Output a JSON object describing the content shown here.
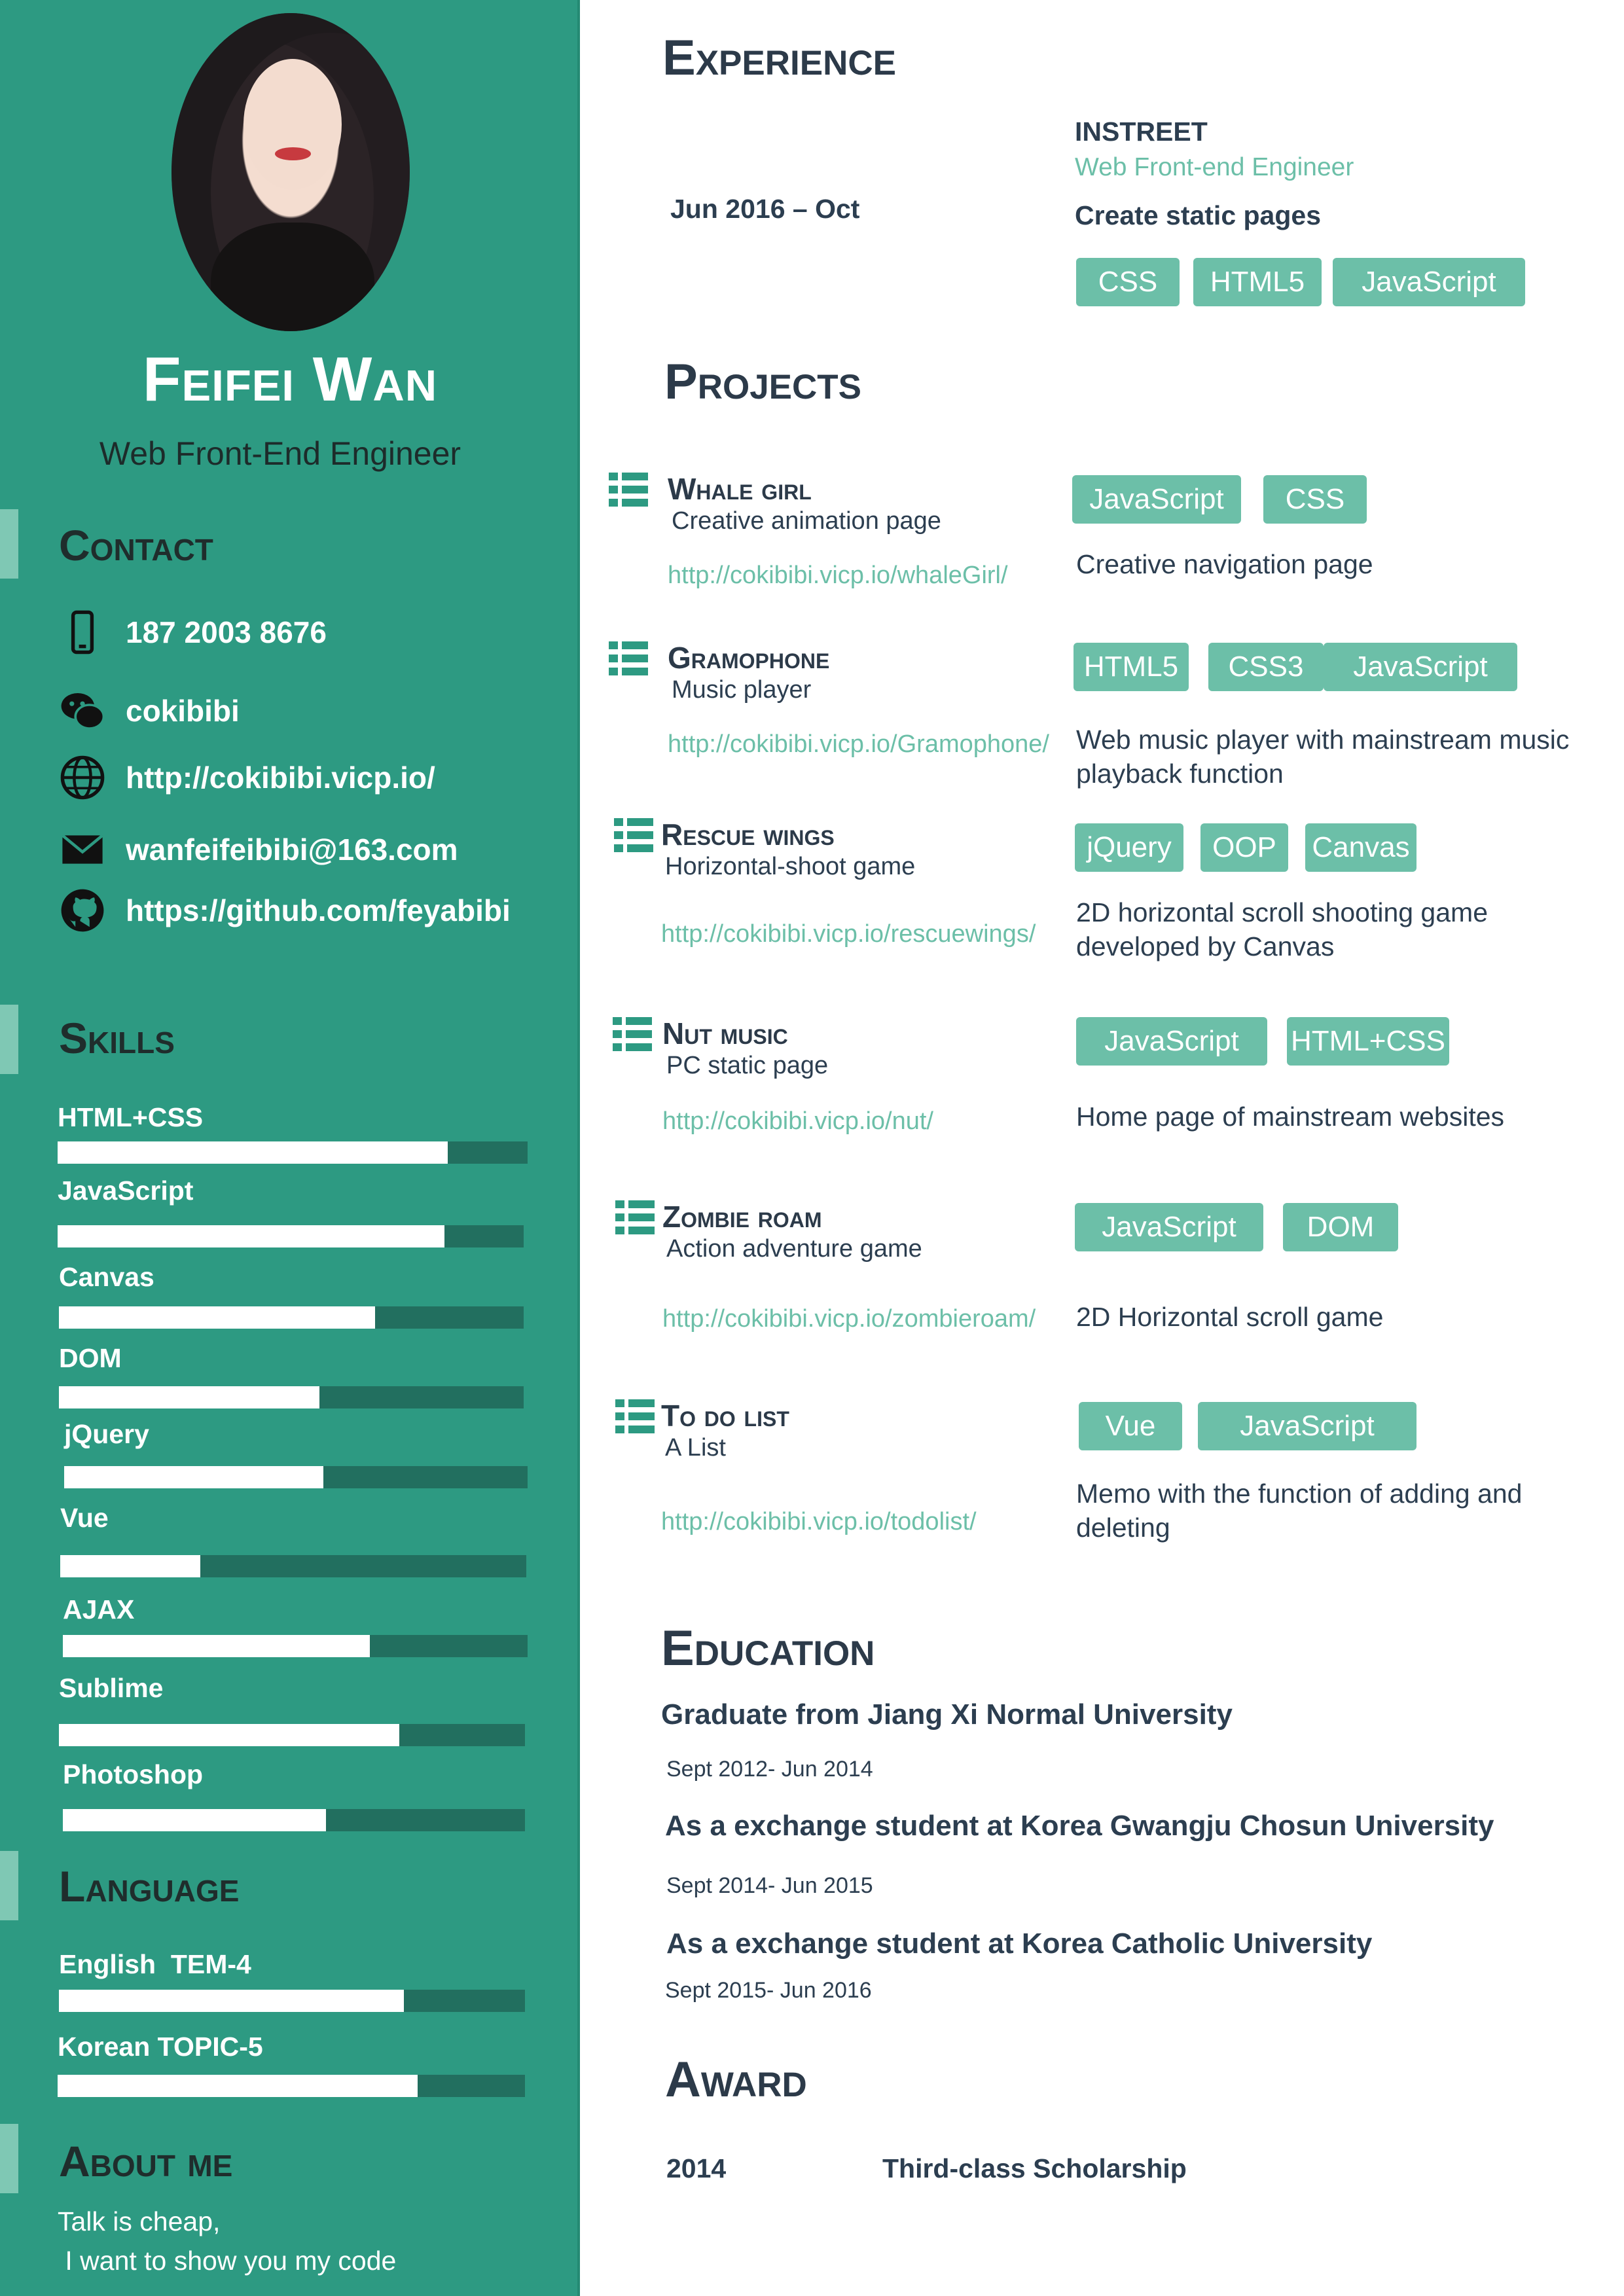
{
  "profile": {
    "name": "Feifei Wan",
    "title": "Web Front-End Engineer"
  },
  "sidebar": {
    "contact_heading": "Contact",
    "contact": [
      {
        "icon": "phone-icon",
        "text": "187 2003 8676"
      },
      {
        "icon": "wechat-icon",
        "text": "cokibibi"
      },
      {
        "icon": "globe-icon",
        "text": "http://cokibibi.vicp.io/"
      },
      {
        "icon": "mail-icon",
        "text": "wanfeifeibibi@163.com"
      },
      {
        "icon": "github-icon",
        "text": "https://github.com/feyabibi"
      }
    ],
    "skills_heading": "Skills",
    "skills": [
      {
        "label": "HTML+CSS",
        "level": 0.83
      },
      {
        "label": "JavaScript",
        "level": 0.83
      },
      {
        "label": "Canvas",
        "level": 0.68
      },
      {
        "label": "DOM",
        "level": 0.56
      },
      {
        "label": "jQuery",
        "level": 0.56
      },
      {
        "label": "Vue",
        "level": 0.3
      },
      {
        "label": "AJAX",
        "level": 0.66
      },
      {
        "label": "Sublime",
        "level": 0.73
      },
      {
        "label": "Photoshop",
        "level": 0.57
      }
    ],
    "language_heading": "Language",
    "languages": [
      {
        "label": "English  TEM-4",
        "level": 0.74
      },
      {
        "label": "Korean TOPIC-5",
        "level": 0.77
      }
    ],
    "about_heading": "About me",
    "about_lines": [
      "Talk is cheap,",
      " I want to show you my code"
    ]
  },
  "experience": {
    "heading": "Experience",
    "period": "Jun 2016 – Oct",
    "company": "INSTREET",
    "role": "Web Front-end Engineer",
    "summary": "Create static pages",
    "tags": [
      "CSS",
      "HTML5",
      "JavaScript"
    ]
  },
  "projects": {
    "heading": "Projects",
    "items": [
      {
        "title": "Whale girl",
        "subtitle": "Creative animation page",
        "link": "http://cokibibi.vicp.io/whaleGirl/",
        "tags": [
          "JavaScript",
          "CSS"
        ],
        "desc": "Creative navigation page"
      },
      {
        "title": "Gramophone",
        "subtitle": "Music player",
        "link": "http://cokibibi.vicp.io/Gramophone/",
        "tags": [
          "HTML5",
          "CSS3",
          "JavaScript"
        ],
        "desc": "Web music player with mainstream music playback function"
      },
      {
        "title": "Rescue wings",
        "subtitle": "Horizontal-shoot game",
        "link": "http://cokibibi.vicp.io/rescuewings/",
        "tags": [
          "jQuery",
          "OOP",
          "Canvas"
        ],
        "desc": "2D horizontal scroll shooting game developed by Canvas"
      },
      {
        "title": "Nut music",
        "subtitle": "PC static page",
        "link": "http://cokibibi.vicp.io/nut/",
        "tags": [
          "JavaScript",
          "HTML+CSS"
        ],
        "desc": "Home page of mainstream websites"
      },
      {
        "title": "Zombie roam",
        "subtitle": "Action adventure game",
        "link": "http://cokibibi.vicp.io/zombieroam/",
        "tags": [
          "JavaScript",
          "DOM"
        ],
        "desc": "2D Horizontal scroll game"
      },
      {
        "title": "To do list",
        "subtitle": "A List",
        "link": "http://cokibibi.vicp.io/todolist/",
        "tags": [
          "Vue",
          "JavaScript"
        ],
        "desc": "Memo with the function of adding and deleting"
      }
    ]
  },
  "education": {
    "heading": "Education",
    "items": [
      {
        "title": "Graduate from Jiang Xi Normal University",
        "period": "Sept 2012- Jun 2014"
      },
      {
        "title": "As a exchange student at Korea Gwangju Chosun University",
        "period": "Sept 2014- Jun 2015"
      },
      {
        "title": "As a exchange student at Korea Catholic University",
        "period": "Sept 2015- Jun 2016"
      }
    ]
  },
  "award": {
    "heading": "Award",
    "year": "2014",
    "title": "Third-class Scholarship"
  },
  "colors": {
    "sidebar": "#2d9a82",
    "accent": "#6cbfa8",
    "bar_track": "#226f5f",
    "heading": "#2c3a49"
  }
}
